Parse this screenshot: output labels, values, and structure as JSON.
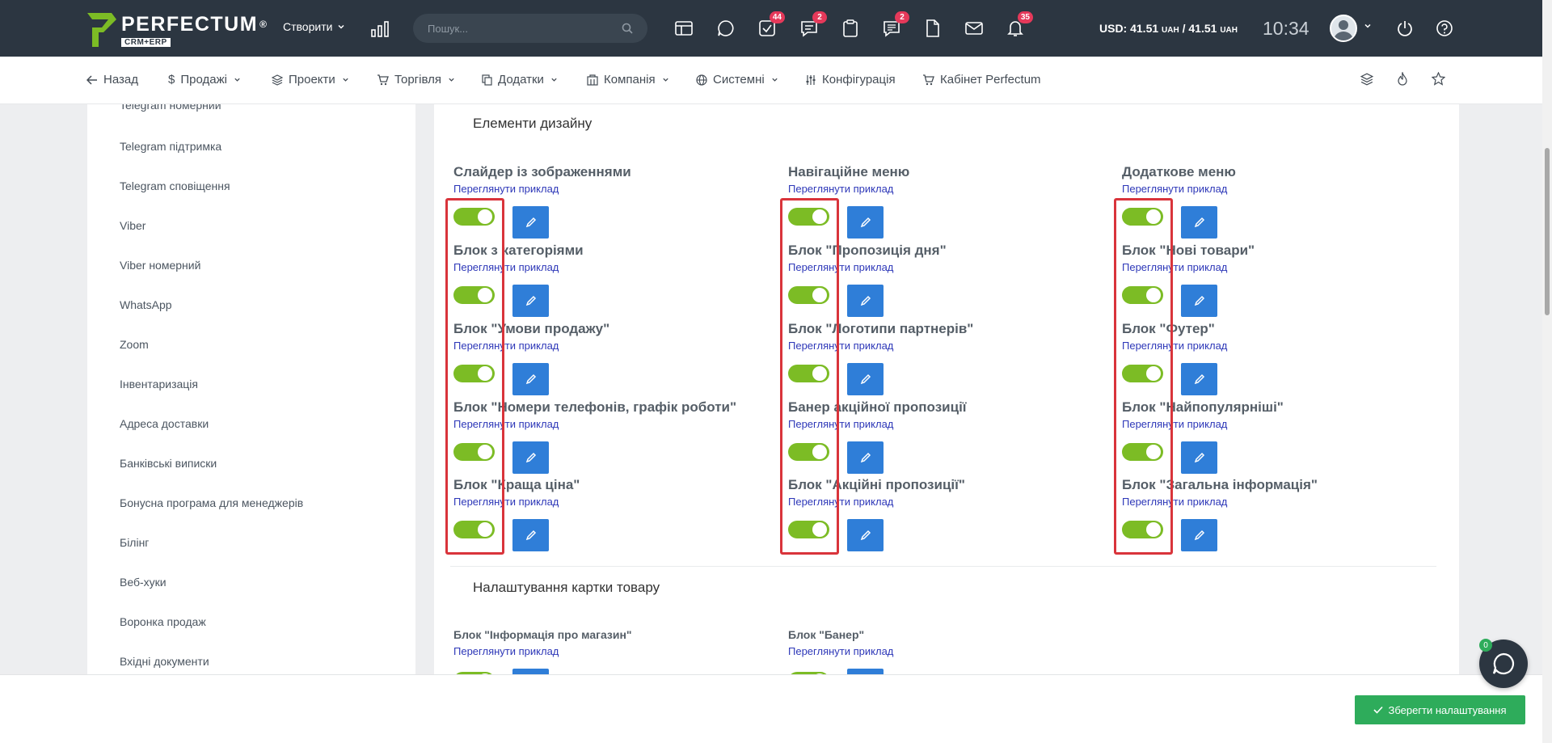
{
  "header": {
    "logo_name": "PERFECTUM",
    "logo_reg": "®",
    "logo_sub": "CRM+ERP",
    "create_label": "Створити",
    "search_placeholder": "Пошук...",
    "badges": {
      "tasks": "44",
      "chat": "2",
      "notes": "2",
      "bell": "35"
    },
    "currency_label": "USD: 41.51",
    "currency_unit1": "UAH",
    "currency_mid": "/ 41.51",
    "currency_unit2": "UAH",
    "time": "10:34"
  },
  "nav": {
    "back": "Назад",
    "items": [
      {
        "label": "Продажі"
      },
      {
        "label": "Проекти"
      },
      {
        "label": "Торгівля"
      },
      {
        "label": "Додатки"
      },
      {
        "label": "Компанія"
      },
      {
        "label": "Системні"
      },
      {
        "label": "Конфігурація"
      },
      {
        "label": "Кабінет Perfectum"
      }
    ]
  },
  "sidebar": {
    "items": [
      "Telegram номерний",
      "Telegram підтримка",
      "Telegram сповіщення",
      "Viber",
      "Viber номерний",
      "WhatsApp",
      "Zoom",
      "Інвентаризація",
      "Адреса доставки",
      "Банківські виписки",
      "Бонусна програма для менеджерів",
      "Білінг",
      "Веб-хуки",
      "Воронка продаж",
      "Вхідні документи"
    ]
  },
  "design": {
    "title": "Елементи дизайну",
    "link_label": "Переглянути приклад",
    "columns": [
      [
        "Слайдер із зображеннями",
        "Блок з категоріями",
        "Блок \"Умови продажу\"",
        "Блок \"Номери телефонів, графік роботи\"",
        "Блок \"Краща ціна\""
      ],
      [
        "Навігаційне меню",
        "Блок \"Пропозиція дня\"",
        "Блок \"Логотипи партнерів\"",
        "Банер акційної пропозиції",
        "Блок \"Акційні пропозиції\""
      ],
      [
        "Додаткове меню",
        "Блок \"Нові товари\"",
        "Блок \"Футер\"",
        "Блок \"Найпопулярніші\"",
        "Блок \"Загальна інформація\""
      ]
    ]
  },
  "card": {
    "title": "Налаштування картки товару",
    "items": [
      "Блок \"Інформація про магазин\"",
      "Блок \"Банер\""
    ]
  },
  "footer": {
    "save_label": "Зберегти налаштування",
    "chat_count": "0"
  },
  "colors": {
    "header_bg": "#2c3641",
    "toggle_on": "#7cbc25",
    "edit_btn": "#2f7ed8",
    "save_btn": "#2eac5b",
    "highlight": "#d9343b",
    "badge": "#e5395a"
  }
}
